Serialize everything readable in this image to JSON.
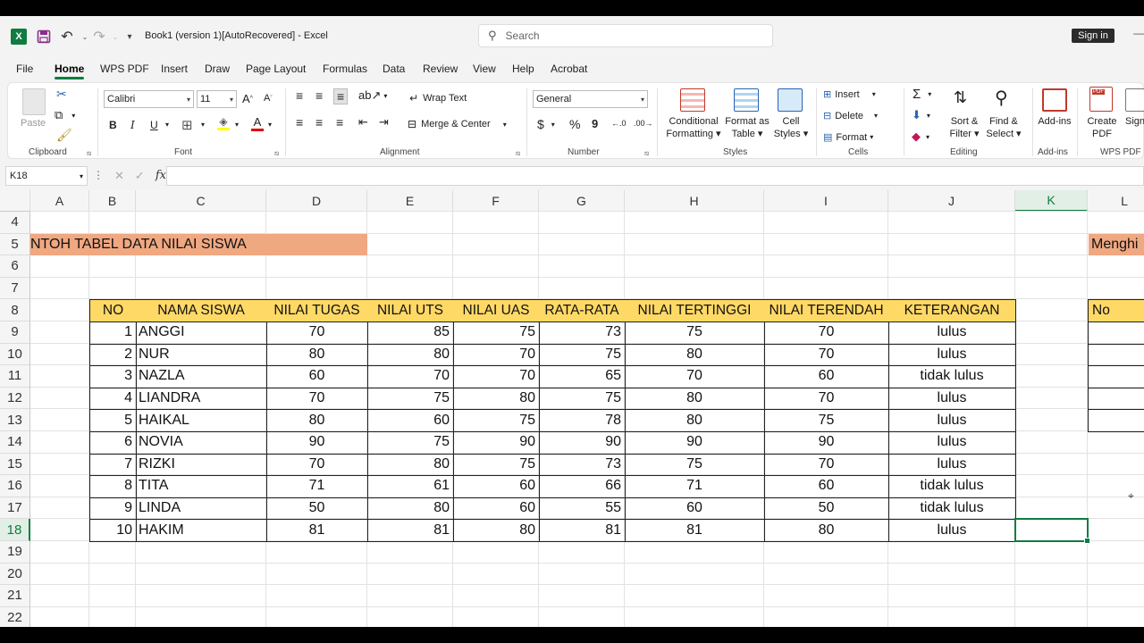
{
  "titlebar": {
    "app_icon_letter": "X",
    "doc_title": "Book1 (version 1)[AutoRecovered]  -  Excel",
    "search_placeholder": "Search",
    "signin": "Sign in"
  },
  "menu": [
    "File",
    "Home",
    "WPS PDF",
    "Insert",
    "Draw",
    "Page Layout",
    "Formulas",
    "Data",
    "Review",
    "View",
    "Help",
    "Acrobat"
  ],
  "ribbon": {
    "clipboard": {
      "paste": "Paste",
      "label": "Clipboard"
    },
    "font": {
      "name": "Calibri",
      "size": "11",
      "bold": "B",
      "italic": "I",
      "underline": "U",
      "label": "Font"
    },
    "alignment": {
      "wrap_text": "Wrap Text",
      "merge_center": "Merge & Center",
      "label": "Alignment"
    },
    "number": {
      "format": "General",
      "currency": "$",
      "percent": "%",
      "comma": "9",
      "label": "Number"
    },
    "styles": {
      "conditional": "Conditional",
      "conditional2": "Formatting",
      "format_table": "Format as",
      "format_table2": "Table",
      "cell_styles": "Cell",
      "cell_styles2": "Styles",
      "label": "Styles"
    },
    "cells": {
      "insert": "Insert",
      "delete": "Delete",
      "format": "Format",
      "label": "Cells"
    },
    "editing": {
      "sort": "Sort &",
      "sort2": "Filter",
      "find": "Find &",
      "find2": "Select",
      "label": "Editing"
    },
    "addins": {
      "addins": "Add-ins",
      "label": "Add-ins"
    },
    "wps": {
      "create": "Create",
      "create2": "PDF",
      "sign": "Sign",
      "label": "WPS PDF"
    }
  },
  "formula_bar": {
    "name_box": "K18",
    "fx": "fx",
    "formula": ""
  },
  "columns": [
    "A",
    "B",
    "C",
    "D",
    "E",
    "F",
    "G",
    "H",
    "I",
    "J",
    "K",
    "L"
  ],
  "rows": [
    "4",
    "5",
    "6",
    "7",
    "8",
    "9",
    "10",
    "11",
    "12",
    "13",
    "14",
    "15",
    "16",
    "17",
    "18",
    "19",
    "20",
    "21",
    "22"
  ],
  "sheet": {
    "title": "NTOH TABEL DATA NILAI SISWA",
    "side_title": "Menghi",
    "side_header": "No",
    "headers": [
      "NO",
      "NAMA SISWA",
      "NILAI TUGAS",
      "NILAI UTS",
      "NILAI UAS",
      "RATA-RATA",
      "NILAI TERTINGGI",
      "NILAI TERENDAH",
      "KETERANGAN"
    ],
    "data": [
      [
        "1",
        "ANGGI",
        "70",
        "85",
        "75",
        "73",
        "75",
        "70",
        "lulus"
      ],
      [
        "2",
        "NUR",
        "80",
        "80",
        "70",
        "75",
        "80",
        "70",
        "lulus"
      ],
      [
        "3",
        "NAZLA",
        "60",
        "70",
        "70",
        "65",
        "70",
        "60",
        "tidak lulus"
      ],
      [
        "4",
        "LIANDRA",
        "70",
        "75",
        "80",
        "75",
        "80",
        "70",
        "lulus"
      ],
      [
        "5",
        "HAIKAL",
        "80",
        "60",
        "75",
        "78",
        "80",
        "75",
        "lulus"
      ],
      [
        "6",
        "NOVIA",
        "90",
        "75",
        "90",
        "90",
        "90",
        "90",
        "lulus"
      ],
      [
        "7",
        "RIZKI",
        "70",
        "80",
        "75",
        "73",
        "75",
        "70",
        "lulus"
      ],
      [
        "8",
        "TITA",
        "71",
        "61",
        "60",
        "66",
        "71",
        "60",
        "tidak lulus"
      ],
      [
        "9",
        "LINDA",
        "50",
        "80",
        "60",
        "55",
        "60",
        "50",
        "tidak lulus"
      ],
      [
        "10",
        "HAKIM",
        "81",
        "81",
        "80",
        "81",
        "81",
        "80",
        "lulus"
      ]
    ]
  },
  "colors": {
    "accent": "#107c41",
    "header_fill": "#ffd966",
    "title_fill": "#f0a881"
  }
}
